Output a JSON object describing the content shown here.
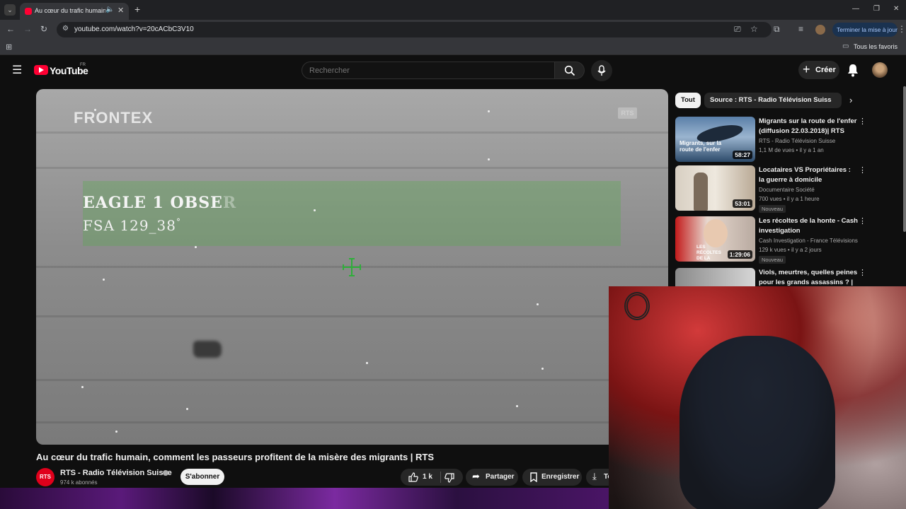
{
  "browser": {
    "tab_title": "Au cœur du trafic humain, c",
    "url": "youtube.com/watch?v=20cACbC3V10",
    "update_button": "Terminer la mise à jour",
    "all_bookmarks": "Tous les favoris"
  },
  "youtube": {
    "wordmark": "YouTube",
    "region": "FR",
    "search": {
      "placeholder": "Rechercher"
    },
    "create_label": "Créer"
  },
  "video": {
    "overlay_logo": "FRONTEX",
    "overlay_watermark": "RTS",
    "overlay_line1": "EAGLE 1 OBSE",
    "overlay_line1_faded": "R",
    "overlay_line2": "FSA 129_38",
    "overlay_line2_suffix": "°",
    "title": "Au cœur du trafic humain, comment les passeurs profitent de la misère des migrants | RTS",
    "channel": "RTS - Radio Télévision Suisse",
    "channel_logo_text": "RTS",
    "subscribers": "974 k abonnés",
    "subscribe_label": "S'abonner",
    "likes": "1 k",
    "share_label": "Partager",
    "save_label": "Enregistrer",
    "download_label": "Te"
  },
  "sidebar": {
    "chips": [
      "Tout",
      "Source : RTS - Radio Télévision Suisse"
    ],
    "recommendations": [
      {
        "title": "Migrants sur la route de l'enfer (diffusion 22.03.2018)| RTS",
        "channel": "RTS - Radio Télévision Suisse",
        "meta": "1,1 M de vues • il y a 1 an",
        "duration": "58:27",
        "thumb_text": "Migrants, sur la route de l'enfer",
        "badge": ""
      },
      {
        "title": "Locataires VS Propriétaires : la guerre à domicile",
        "channel": "Documentaire Société",
        "meta": "700 vues • il y a 1 heure",
        "duration": "53:01",
        "thumb_text": "",
        "badge": "Nouveau"
      },
      {
        "title": "Les récoltes de la honte - Cash investigation",
        "channel": "Cash Investigation - France Télévisions",
        "meta": "129 k vues • il y a 2 jours",
        "duration": "1:29:06",
        "thumb_text": "LES RÉCOLTES DE LA HONTE",
        "badge": "Nouveau"
      },
      {
        "title": "Viols, meurtres, quelles peines pour les grands assassins ? | ...",
        "channel": "",
        "meta": "",
        "duration": "",
        "thumb_text": "",
        "badge": ""
      }
    ]
  }
}
